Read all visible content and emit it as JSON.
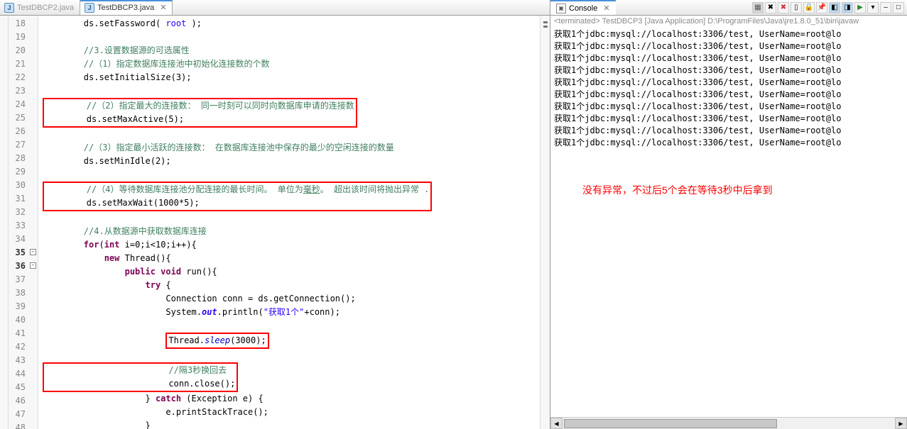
{
  "editor": {
    "tabs": [
      {
        "label": "TestDBCP2.java",
        "active": false
      },
      {
        "label": "TestDBCP3.java",
        "active": true
      }
    ],
    "line_start": 18,
    "line_end": 48,
    "lines": [
      {
        "n": 18,
        "html": "ds.setFassword( <span class='str'>root</span> );"
      },
      {
        "n": 19,
        "html": ""
      },
      {
        "n": 20,
        "html": "<span class='cm'>//3.设置数据源的可选属性</span>"
      },
      {
        "n": 21,
        "html": "<span class='cm'>//（1）指定数据库连接池中初始化连接数的个数</span>"
      },
      {
        "n": 22,
        "html": "ds.setInitialSize(3);"
      },
      {
        "n": 23,
        "html": ""
      },
      {
        "n": 24,
        "html": "<span class='cm'>//（2）指定最大的连接数： 同一时刻可以同时向数据库申请的连接数</span>",
        "box": "start"
      },
      {
        "n": 25,
        "html": "ds.setMaxActive(5);",
        "box": "end"
      },
      {
        "n": 26,
        "html": ""
      },
      {
        "n": 27,
        "html": "<span class='cm'>//（3）指定最小活跃的连接数： 在数据库连接池中保存的最少的空闲连接的数量</span>"
      },
      {
        "n": 28,
        "html": "ds.setMinIdle(2);"
      },
      {
        "n": 29,
        "html": ""
      },
      {
        "n": 30,
        "html": "<span class='cm'>//（4）等待数据库连接池分配连接的最长时间。 单位为<u>毫秒</u>。 超出该时间将抛出异常 .</span>",
        "box": "start2"
      },
      {
        "n": 31,
        "html": "ds.setMaxWait(1000*5);",
        "box": "end2"
      },
      {
        "n": 32,
        "html": ""
      },
      {
        "n": 33,
        "html": "<span class='cm'>//4.从数据源中获取数据库连接</span>"
      },
      {
        "n": 34,
        "html": "<span class='kw'>for</span>(<span class='kw'>int</span> i=0;i&lt;10;i++){"
      },
      {
        "n": 35,
        "fold": true,
        "mark": true,
        "html": "    <span class='kw'>new</span> Thread(){"
      },
      {
        "n": 36,
        "fold": true,
        "mark": true,
        "html": "        <span class='kw'>public void</span> run(){"
      },
      {
        "n": 37,
        "html": "            <span class='kw'>try</span> {"
      },
      {
        "n": 38,
        "html": "                Connection conn = ds.getConnection();"
      },
      {
        "n": 39,
        "html": "                System.<span class='sbit'>out</span>.println(<span class='str'>\"获取1个\"</span>+conn);"
      },
      {
        "n": 40,
        "html": ""
      },
      {
        "n": 41,
        "html": "                <span class='red-box'>Thread.<span class='sit'>sleep</span>(3000);</span>"
      },
      {
        "n": 42,
        "html": ""
      },
      {
        "n": 43,
        "html": "                <span class='cm'>//隔3秒换回去</span>",
        "box": "start3"
      },
      {
        "n": 44,
        "html": "                conn.close();",
        "box": "end3"
      },
      {
        "n": 45,
        "html": "            } <span class='kw'>catch</span> (Exception e) {"
      },
      {
        "n": 46,
        "html": "                e.printStackTrace();"
      },
      {
        "n": 47,
        "html": "            }"
      },
      {
        "n": 48,
        "html": "        }"
      }
    ]
  },
  "console": {
    "title": "Console",
    "process": "<terminated> TestDBCP3 [Java Application] D:\\ProgramFiles\\Java\\jre1.8.0_51\\bin\\javaw",
    "output_line": "获取1个jdbc:mysql://localhost:3306/test, UserName=root@lo",
    "output_count": 10,
    "annotation": "没有异常，不过后5个会在等待3秒中后拿到"
  }
}
